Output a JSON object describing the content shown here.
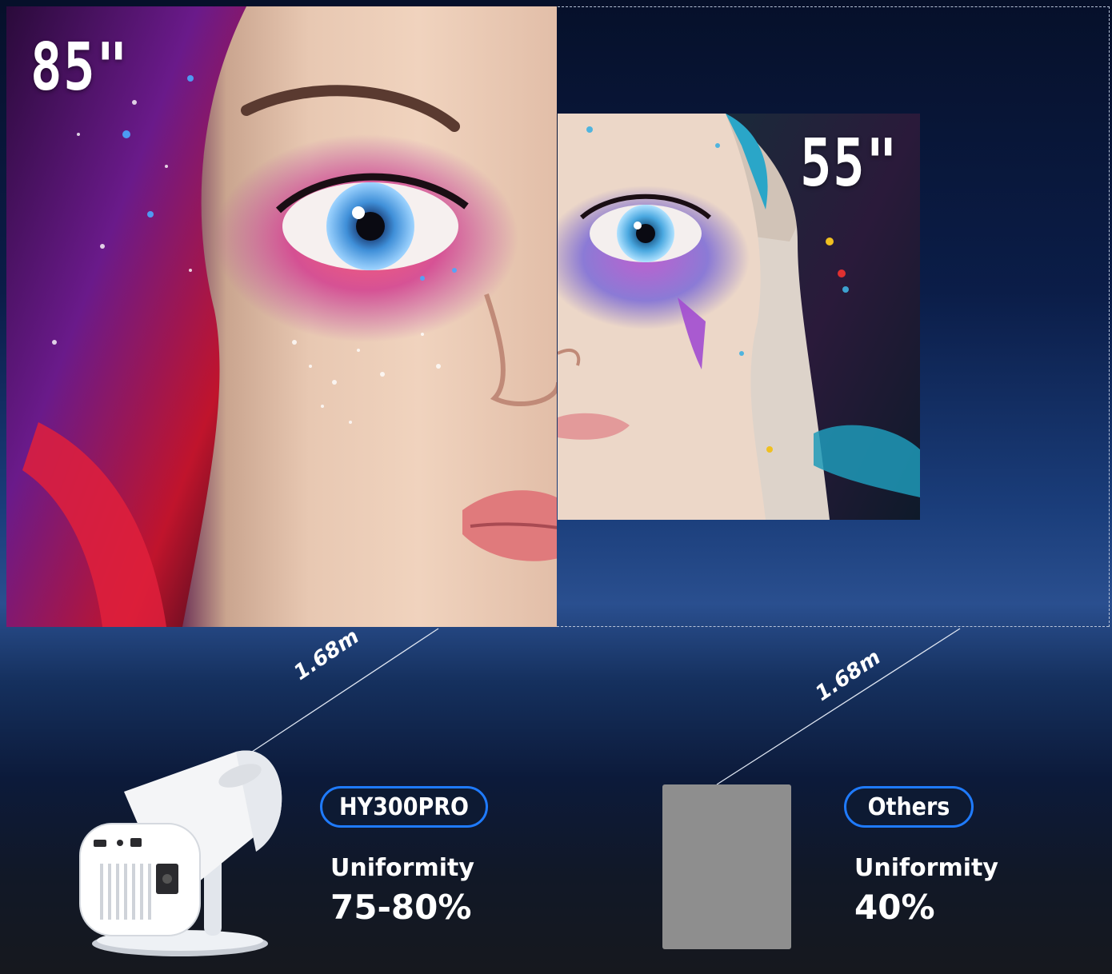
{
  "comparison": {
    "left": {
      "screen_size": "85\"",
      "distance": "1.68m",
      "badge": "HY300PRO",
      "metric_label": "Uniformity",
      "metric_value": "75-80%"
    },
    "right": {
      "screen_size": "55\"",
      "distance": "1.68m",
      "badge": "Others",
      "metric_label": "Uniformity",
      "metric_value": "40%"
    }
  },
  "colors": {
    "accent": "#1f7bff",
    "background_top": "#06102a",
    "background_bottom": "#16181e",
    "placeholder_device": "#8e8e8e"
  }
}
